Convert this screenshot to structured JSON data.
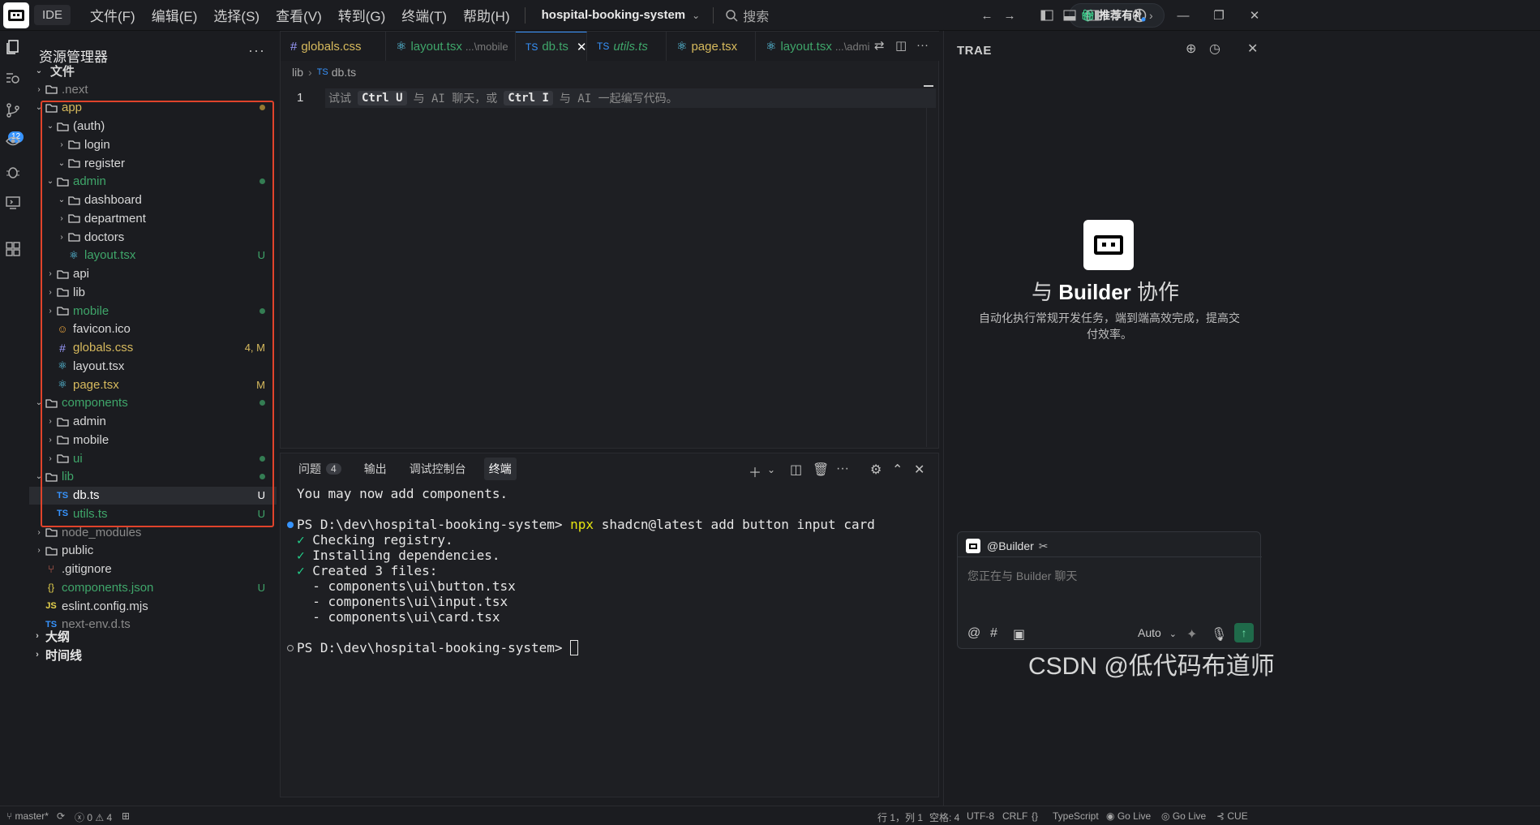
{
  "titlebar": {
    "ide_label": "IDE",
    "menus": [
      "文件(F)",
      "编辑(E)",
      "选择(S)",
      "查看(V)",
      "转到(G)",
      "终端(T)",
      "帮助(H)"
    ],
    "project": "hospital-booking-system",
    "search_placeholder": "搜索",
    "gift_label": "推荐有礼"
  },
  "activity": {
    "scm_badge": "12"
  },
  "sidebar": {
    "title": "资源管理器",
    "root_label": "文件",
    "tree": [
      {
        "name": ".next",
        "badge": ""
      },
      {
        "name": "app",
        "badge": ""
      },
      {
        "name": "(auth)",
        "badge": ""
      },
      {
        "name": "login",
        "badge": ""
      },
      {
        "name": "register",
        "badge": ""
      },
      {
        "name": "admin",
        "badge": ""
      },
      {
        "name": "dashboard",
        "badge": ""
      },
      {
        "name": "department",
        "badge": ""
      },
      {
        "name": "doctors",
        "badge": ""
      },
      {
        "name": "layout.tsx",
        "badge": "U"
      },
      {
        "name": "api",
        "badge": ""
      },
      {
        "name": "lib",
        "badge": ""
      },
      {
        "name": "mobile",
        "badge": ""
      },
      {
        "name": "favicon.ico",
        "badge": ""
      },
      {
        "name": "globals.css",
        "badge": "4, M"
      },
      {
        "name": "layout.tsx",
        "badge": ""
      },
      {
        "name": "page.tsx",
        "badge": "M"
      },
      {
        "name": "components",
        "badge": ""
      },
      {
        "name": "admin",
        "badge": ""
      },
      {
        "name": "mobile",
        "badge": ""
      },
      {
        "name": "ui",
        "badge": ""
      },
      {
        "name": "lib",
        "badge": ""
      },
      {
        "name": "db.ts",
        "badge": "U"
      },
      {
        "name": "utils.ts",
        "badge": "U"
      },
      {
        "name": "node_modules",
        "badge": ""
      },
      {
        "name": "public",
        "badge": ""
      },
      {
        "name": ".gitignore",
        "badge": ""
      },
      {
        "name": "components.json",
        "badge": "U"
      },
      {
        "name": "eslint.config.mjs",
        "badge": ""
      },
      {
        "name": "next-env.d.ts",
        "badge": ""
      }
    ],
    "outline_label": "大纲",
    "timeline_label": "时间线"
  },
  "editor": {
    "tabs": [
      {
        "label": "globals.css",
        "hint": ""
      },
      {
        "label": "layout.tsx",
        "hint": "...\\mobile"
      },
      {
        "label": "db.ts",
        "hint": ""
      },
      {
        "label": "utils.ts",
        "hint": ""
      },
      {
        "label": "page.tsx",
        "hint": ""
      },
      {
        "label": "layout.tsx",
        "hint": "...\\admin"
      }
    ],
    "breadcrumb": [
      "lib",
      "db.ts"
    ],
    "line_number": "1",
    "hint_prefix": "试试",
    "hint_key1": "Ctrl U",
    "hint_mid": "与 AI 聊天，或",
    "hint_key2": "Ctrl I",
    "hint_suffix": "与 AI 一起编写代码。"
  },
  "panel": {
    "tabs": [
      "问题",
      "输出",
      "调试控制台",
      "终端"
    ],
    "problems_count": "4",
    "terminal": {
      "line1": "You may now add components.",
      "prompt": "PS D:\\dev\\hospital-booking-system> ",
      "cmd_npx": "npx",
      "cmd_rest": " shadcn@latest add button input card",
      "check": "✓",
      "c1": "Checking registry.",
      "c2": "Installing dependencies.",
      "c3": "Created 3 files:",
      "f1": "  - components\\ui\\button.tsx",
      "f2": "  - components\\ui\\input.tsx",
      "f3": "  - components\\ui\\card.tsx"
    }
  },
  "right_panel": {
    "title": "TRAE",
    "heading_prefix": "与",
    "heading_bold": "Builder",
    "heading_suffix": "协作",
    "desc": "自动化执行常规开发任务，端到端高效完成，提高交付效率。",
    "agent": "@Builder",
    "input_placeholder": "您正在与 Builder 聊天",
    "mode": "Auto"
  },
  "statusbar": {
    "branch": "master*",
    "errors": "0",
    "warnings": "4",
    "position": "行 1，列 1",
    "spaces": "空格: 4",
    "encoding": "UTF-8",
    "eol": "CRLF",
    "braces": "{}",
    "language": "TypeScript",
    "golive1": "Go Live",
    "golive2": "Go Live",
    "cue": "CUE"
  },
  "watermark": "CSDN @低代码布道师",
  "colors": {
    "accent": "#3794ff",
    "git_untracked": "#3fa66a",
    "git_modified": "#d7ba5d",
    "highlight_box": "#e0432b"
  }
}
